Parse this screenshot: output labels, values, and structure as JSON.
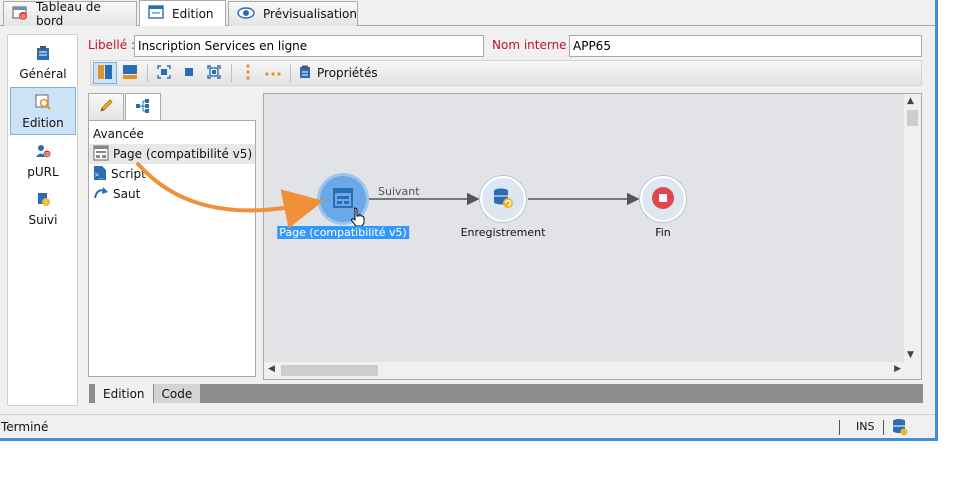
{
  "tabs": [
    {
      "label": "Tableau de bord",
      "icon": "dashboard-icon"
    },
    {
      "label": "Edition",
      "icon": "edit-window-icon"
    },
    {
      "label": "Prévisualisation",
      "icon": "eye-icon"
    }
  ],
  "sidebar": {
    "items": [
      {
        "label": "Général",
        "icon": "general-icon"
      },
      {
        "label": "Edition",
        "icon": "edition-icon"
      },
      {
        "label": "pURL",
        "icon": "purl-icon"
      },
      {
        "label": "Suivi",
        "icon": "tracking-icon"
      }
    ]
  },
  "form": {
    "label_caption": "Libellé :",
    "label_value": "Inscription Services en ligne",
    "internal_caption": "Nom interne :",
    "internal_value": "APP65"
  },
  "toolbar": {
    "properties_label": "Propriétés"
  },
  "palette": {
    "group": "Avancée",
    "items": [
      {
        "label": "Page (compatibilité v5)",
        "icon": "page-icon"
      },
      {
        "label": "Script",
        "icon": "script-icon"
      },
      {
        "label": "Saut",
        "icon": "jump-icon"
      }
    ]
  },
  "workflow": {
    "nodes": [
      {
        "label": "Page (compatibilité v5)",
        "icon": "page-icon"
      },
      {
        "label": "Enregistrement",
        "icon": "database-save-icon"
      },
      {
        "label": "Fin",
        "icon": "stop-icon"
      }
    ],
    "transition_label": "Suivant"
  },
  "bottom_tabs": [
    "Edition",
    "Code"
  ],
  "status": {
    "text": "Terminé",
    "mode": "INS"
  },
  "colors": {
    "accent": "#3c8fd9",
    "required_label": "#c8102e",
    "selection": "#3399ff",
    "drag_arrow": "#f0913a"
  }
}
